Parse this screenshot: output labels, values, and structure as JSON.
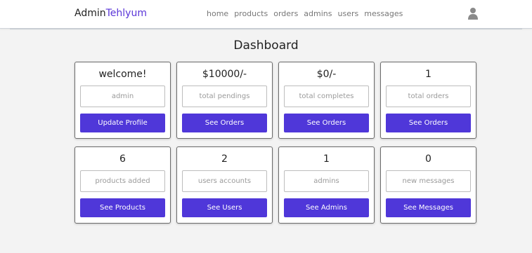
{
  "header": {
    "logo_main": "Admin",
    "logo_brand": "Tehlyum",
    "nav": [
      "home",
      "products",
      "orders",
      "admins",
      "users",
      "messages"
    ]
  },
  "page_title": "Dashboard",
  "cards": [
    {
      "value": "welcome!",
      "label": "admin",
      "button": "Update Profile"
    },
    {
      "value": "$10000/-",
      "label": "total pendings",
      "button": "See Orders"
    },
    {
      "value": "$0/-",
      "label": "total completes",
      "button": "See Orders"
    },
    {
      "value": "1",
      "label": "total orders",
      "button": "See Orders"
    },
    {
      "value": "6",
      "label": "products added",
      "button": "See Products"
    },
    {
      "value": "2",
      "label": "users accounts",
      "button": "See Users"
    },
    {
      "value": "1",
      "label": "admins",
      "button": "See Admins"
    },
    {
      "value": "0",
      "label": "new messages",
      "button": "See Messages"
    }
  ],
  "colors": {
    "accent": "#4f37d9",
    "brand": "#5a35d8"
  }
}
